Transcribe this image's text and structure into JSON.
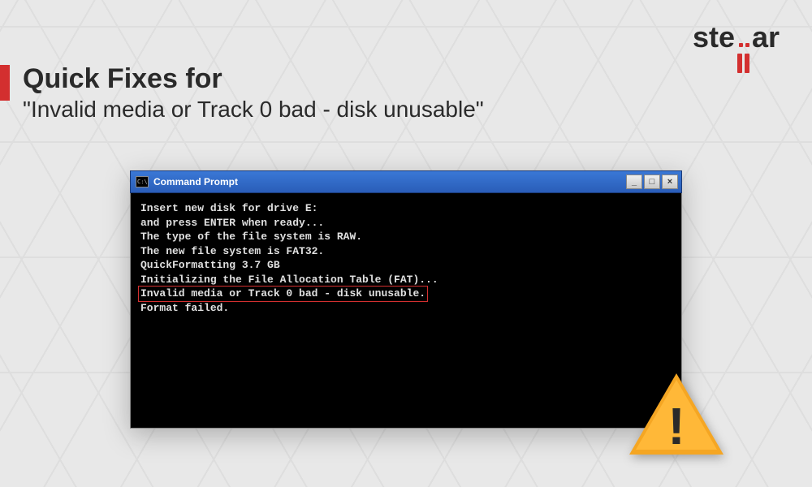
{
  "brand": {
    "name_part1": "ste",
    "name_part2": "ar"
  },
  "heading": {
    "line1": "Quick Fixes for",
    "line2": "\"Invalid media or Track 0 bad - disk unusable\""
  },
  "cmd": {
    "title": "Command Prompt",
    "icon_text": "C:\\",
    "buttons": {
      "minimize": "_",
      "maximize": "□",
      "close": "×"
    },
    "lines": [
      "Insert new disk for drive E:",
      "and press ENTER when ready...",
      "The type of the file system is RAW.",
      "The new file system is FAT32.",
      "QuickFormatting 3.7 GB",
      "Initializing the File Allocation Table (FAT)...",
      "Invalid media or Track 0 bad - disk unusable.",
      "Format failed."
    ],
    "highlighted_index": 6
  },
  "warning": {
    "mark": "!"
  }
}
